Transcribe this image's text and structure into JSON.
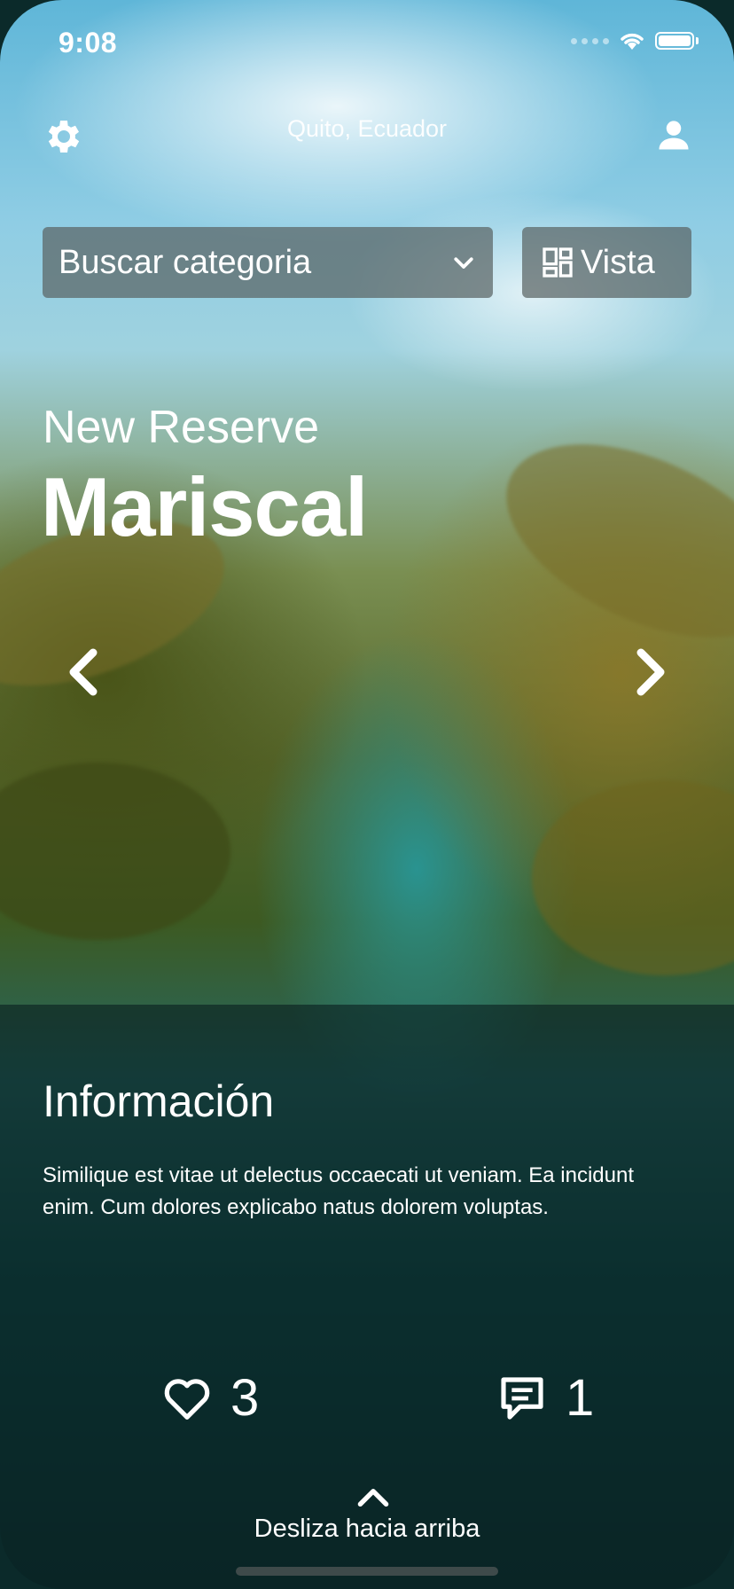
{
  "status_bar": {
    "time": "9:08"
  },
  "header": {
    "location": "Quito, Ecuador",
    "settings_icon": "gear-icon",
    "profile_icon": "user-icon"
  },
  "filters": {
    "category_dropdown": "Buscar categoria",
    "view_button": "Vista"
  },
  "hero": {
    "subtitle": "New Reserve",
    "title": "Mariscal"
  },
  "info": {
    "heading": "Información",
    "description": "Similique est vitae ut delectus occaecati ut veniam. Ea incidunt enim. Cum dolores explicabo natus dolorem voluptas.",
    "likes": "3",
    "comments": "1",
    "swipe_hint": "Desliza hacia arriba"
  },
  "colors": {
    "text": "#ffffff",
    "control_bg": "#5a6464",
    "panel_bg": "#0a1e1e"
  }
}
